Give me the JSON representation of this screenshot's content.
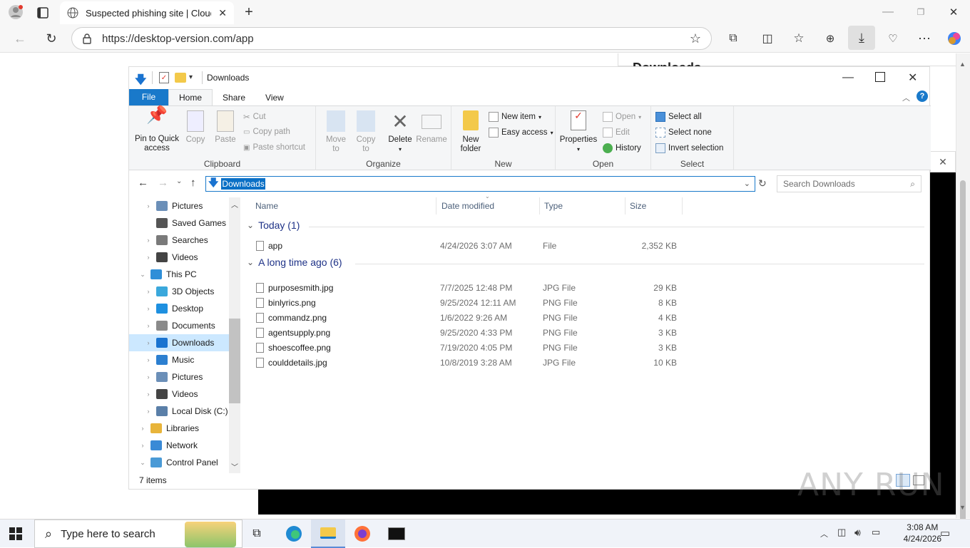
{
  "browser": {
    "tab_title": "Suspected phishing site | Cloudfla",
    "url": "https://desktop-version.com/app",
    "accent": "#0b70c6"
  },
  "explorer": {
    "title": "Downloads",
    "ribbon_tabs": [
      "File",
      "Home",
      "Share",
      "View"
    ],
    "clipboard": {
      "pin": "Pin to Quick\naccess",
      "copy": "Copy",
      "paste": "Paste",
      "cut": "Cut",
      "copy_path": "Copy path",
      "paste_shortcut": "Paste shortcut",
      "label": "Clipboard"
    },
    "organize": {
      "move_to": "Move\nto",
      "copy_to": "Copy\nto",
      "delete": "Delete",
      "rename": "Rename",
      "label": "Organize"
    },
    "new": {
      "new_folder": "New\nfolder",
      "new_item": "New item",
      "easy_access": "Easy access",
      "label": "New"
    },
    "open": {
      "properties": "Properties",
      "open": "Open",
      "edit": "Edit",
      "history": "History",
      "label": "Open"
    },
    "select": {
      "select_all": "Select all",
      "select_none": "Select none",
      "invert": "Invert selection",
      "label": "Select"
    },
    "address": "Downloads",
    "search_placeholder": "Search Downloads",
    "nav": [
      {
        "label": "Pictures",
        "chev": "›",
        "indent": 2,
        "color": "#6b8fb8"
      },
      {
        "label": "Saved Games",
        "chev": "",
        "indent": 2,
        "color": "#555"
      },
      {
        "label": "Searches",
        "chev": "›",
        "indent": 2,
        "color": "#7a7a7a"
      },
      {
        "label": "Videos",
        "chev": "›",
        "indent": 2,
        "color": "#444"
      },
      {
        "label": "This PC",
        "chev": "⌄",
        "indent": 1,
        "color": "#2f8fd8"
      },
      {
        "label": "3D Objects",
        "chev": "›",
        "indent": 2,
        "color": "#3aa8dc"
      },
      {
        "label": "Desktop",
        "chev": "›",
        "indent": 2,
        "color": "#1e90e0"
      },
      {
        "label": "Documents",
        "chev": "›",
        "indent": 2,
        "color": "#8a8a8a"
      },
      {
        "label": "Downloads",
        "chev": "›",
        "indent": 2,
        "color": "#1a73d0",
        "selected": true
      },
      {
        "label": "Music",
        "chev": "›",
        "indent": 2,
        "color": "#2c7fd0"
      },
      {
        "label": "Pictures",
        "chev": "›",
        "indent": 2,
        "color": "#6b8fb8"
      },
      {
        "label": "Videos",
        "chev": "›",
        "indent": 2,
        "color": "#444"
      },
      {
        "label": "Local Disk (C:)",
        "chev": "›",
        "indent": 2,
        "color": "#5a7fa8"
      },
      {
        "label": "Libraries",
        "chev": "›",
        "indent": 1,
        "color": "#e8b43a"
      },
      {
        "label": "Network",
        "chev": "›",
        "indent": 1,
        "color": "#3a8ad6"
      },
      {
        "label": "Control Panel",
        "chev": "⌄",
        "indent": 1,
        "color": "#4a9ad6"
      }
    ],
    "columns": [
      "Name",
      "Date modified",
      "Type",
      "Size"
    ],
    "groups": [
      {
        "title": "Today (1)",
        "files": [
          {
            "name": "app",
            "date": "4/24/2026 3:07 AM",
            "type": "File",
            "size": "2,352 KB"
          }
        ]
      },
      {
        "title": "A long time ago (6)",
        "files": [
          {
            "name": "purposesmith.jpg",
            "date": "7/7/2025 12:48 PM",
            "type": "JPG File",
            "size": "29 KB"
          },
          {
            "name": "binlyrics.png",
            "date": "9/25/2024 12:11 AM",
            "type": "PNG File",
            "size": "8 KB"
          },
          {
            "name": "commandz.png",
            "date": "1/6/2022 9:26 AM",
            "type": "PNG File",
            "size": "4 KB"
          },
          {
            "name": "agentsupply.png",
            "date": "9/25/2020 4:33 PM",
            "type": "PNG File",
            "size": "3 KB"
          },
          {
            "name": "shoescoffee.png",
            "date": "7/19/2020 4:05 PM",
            "type": "PNG File",
            "size": "3 KB"
          },
          {
            "name": "coulddetails.jpg",
            "date": "10/8/2019 3:28 AM",
            "type": "JPG File",
            "size": "10 KB"
          }
        ]
      }
    ],
    "status": "7 items"
  },
  "downloads_panel": {
    "title_fragment": "Downloads"
  },
  "taskbar": {
    "search_placeholder": "Type here to search",
    "time": "3:08 AM",
    "date": "4/24/2026"
  },
  "watermark": "ANY RUN"
}
